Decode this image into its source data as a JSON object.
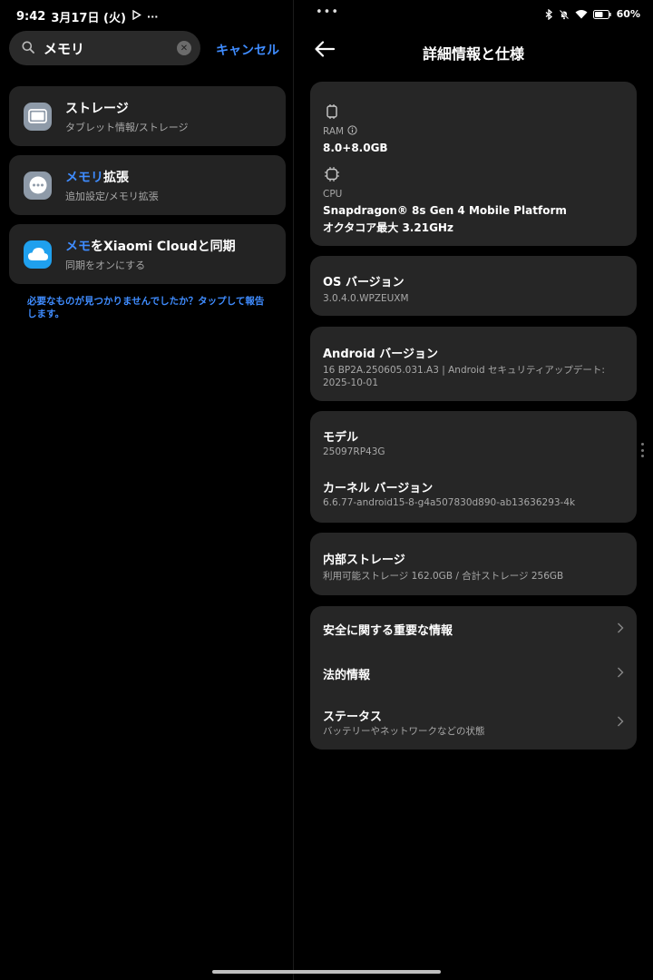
{
  "status_bar": {
    "time": "9:42",
    "date": "3月17日 (火)",
    "left_icons": [
      "play-store-icon",
      "more-dots-icon"
    ],
    "dots": "•••",
    "battery": "60%",
    "right_icons": [
      "bluetooth-icon",
      "bell-off-icon",
      "wifi-icon",
      "battery-icon"
    ]
  },
  "search": {
    "query": "メモリ",
    "cancel_label": "キャンセル"
  },
  "results": [
    {
      "icon": "storage-icon",
      "icon_color": "#8e9aa8",
      "title_plain": "ストレージ",
      "title_highlight": "",
      "title_rest": "",
      "subtitle": "タブレット情報/ストレージ"
    },
    {
      "icon": "memory-expansion-icon",
      "icon_color": "#8e9aa8",
      "title_plain": "",
      "title_highlight": "メモリ",
      "title_rest": "拡張",
      "subtitle": "追加設定/メモリ拡張"
    },
    {
      "icon": "xiaomi-cloud-icon",
      "icon_color": "#1fa0ee",
      "title_plain": "",
      "title_highlight": "メモ",
      "title_rest": "をXiaomi Cloudと同期",
      "subtitle": "同期をオンにする"
    }
  ],
  "feedback_text": "必要なものが見つかりませんでしたか？タップして報告します。",
  "detail": {
    "title": "詳細情報と仕様",
    "ram_label": "RAM",
    "ram_value": "8.0+8.0GB",
    "cpu_label": "CPU",
    "cpu_value_line1": "Snapdragon® 8s Gen 4 Mobile Platform",
    "cpu_value_line2": "オクタコア最大 3.21GHz",
    "os_title": "OS バージョン",
    "os_value": "3.0.4.0.WPZEUXM",
    "android_title": "Android バージョン",
    "android_value": "16 BP2A.250605.031.A3 | Android セキュリティアップデート: 2025-10-01",
    "model_title": "モデル",
    "model_value": "25097RP43G",
    "kernel_title": "カーネル バージョン",
    "kernel_value": "6.6.77-android15-8-g4a507830d890-ab13636293-4k",
    "storage_title": "内部ストレージ",
    "storage_value": "利用可能ストレージ  162.0GB / 合計ストレージ  256GB",
    "safety_title": "安全に関する重要な情報",
    "legal_title": "法的情報",
    "status_title": "ステータス",
    "status_value": "バッテリーやネットワークなどの状態"
  },
  "colors": {
    "accent": "#3f8cff",
    "card": "#262626",
    "background": "#000000"
  }
}
